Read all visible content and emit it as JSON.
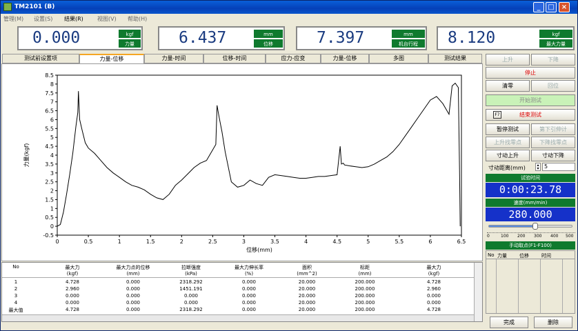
{
  "window": {
    "title": "TM2101 (B)"
  },
  "menu": [
    "管理(M)",
    "设置(S)",
    "结果(R)",
    "视图(V)",
    "帮助(H)"
  ],
  "readouts": [
    {
      "value": "0.000",
      "unit": "kgf",
      "label": "力量"
    },
    {
      "value": "6.437",
      "unit": "mm",
      "label": "位移"
    },
    {
      "value": "7.397",
      "unit": "mm",
      "label": "机台行程"
    },
    {
      "value": "8.120",
      "unit": "kgf",
      "label": "最大力量"
    }
  ],
  "tabs": [
    "测试前设置项",
    "力量-位移",
    "力量-时间",
    "位移-时间",
    "应力-应变",
    "力量-位移",
    "多图",
    "测试结果"
  ],
  "active_tab": 1,
  "chart_data": {
    "type": "line",
    "xlabel": "位移(mm)",
    "ylabel": "力量(kgf)",
    "xlim": [
      0,
      6.5
    ],
    "ylim": [
      -0.5,
      8.5
    ],
    "x_ticks": [
      "0",
      "0.5",
      "1",
      "1.5",
      "2",
      "2.5",
      "3",
      "3.5",
      "4",
      "4.5",
      "5",
      "5.5",
      "6",
      "6.5"
    ],
    "y_ticks": [
      "-0.5",
      "0",
      "0.5",
      "1",
      "1.5",
      "2",
      "2.5",
      "3",
      "3.5",
      "4",
      "4.5",
      "5",
      "5.5",
      "6",
      "6.5",
      "7",
      "7.5",
      "8",
      "8.5"
    ],
    "grid": false,
    "series": [
      {
        "color": "#000000",
        "x": [
          0,
          0.05,
          0.1,
          0.15,
          0.2,
          0.25,
          0.3,
          0.33,
          0.34,
          0.36,
          0.4,
          0.45,
          0.5,
          0.6,
          0.7,
          0.8,
          0.9,
          1.0,
          1.1,
          1.2,
          1.3,
          1.4,
          1.5,
          1.6,
          1.7,
          1.8,
          1.9,
          2.0,
          2.1,
          2.2,
          2.3,
          2.4,
          2.5,
          2.55,
          2.57,
          2.6,
          2.65,
          2.7,
          2.8,
          2.9,
          2.95,
          3.0,
          3.1,
          3.2,
          3.3,
          3.4,
          3.5,
          3.6,
          3.7,
          3.8,
          3.9,
          4.0,
          4.1,
          4.2,
          4.3,
          4.4,
          4.5,
          4.55,
          4.57,
          4.6,
          4.62,
          4.7,
          4.8,
          4.9,
          5.0,
          5.1,
          5.2,
          5.3,
          5.4,
          5.5,
          5.6,
          5.7,
          5.8,
          5.9,
          6.0,
          6.1,
          6.2,
          6.3,
          6.35,
          6.4,
          6.45,
          6.47,
          6.48
        ],
        "y": [
          0.0,
          0.1,
          0.8,
          1.8,
          2.9,
          4.1,
          5.6,
          6.4,
          7.6,
          6.0,
          5.4,
          4.7,
          4.4,
          4.1,
          3.7,
          3.3,
          3.0,
          2.75,
          2.5,
          2.3,
          2.2,
          2.05,
          1.8,
          1.6,
          1.5,
          1.8,
          2.3,
          2.6,
          2.95,
          3.3,
          3.55,
          3.7,
          4.3,
          4.6,
          6.8,
          6.2,
          5.3,
          4.2,
          2.5,
          2.2,
          2.25,
          2.3,
          2.6,
          2.4,
          2.3,
          2.75,
          2.9,
          2.85,
          2.8,
          2.75,
          2.7,
          2.7,
          2.75,
          2.8,
          2.8,
          2.85,
          2.9,
          4.5,
          3.5,
          3.55,
          3.45,
          3.4,
          3.35,
          3.3,
          3.35,
          3.5,
          3.7,
          3.9,
          4.2,
          4.6,
          5.1,
          5.6,
          6.1,
          6.6,
          7.1,
          7.3,
          6.9,
          6.3,
          7.9,
          8.05,
          7.8,
          3.0,
          0.0
        ]
      }
    ]
  },
  "table": {
    "headers": [
      [
        "No",
        ""
      ],
      [
        "最大力",
        "(kgf)"
      ],
      [
        "最大力点的位移",
        "(mm)"
      ],
      [
        "拉断强度",
        "(kPa)"
      ],
      [
        "最大力伸长率",
        "(%)"
      ],
      [
        "面积",
        "(mm^2)"
      ],
      [
        "标距",
        "(mm)"
      ],
      [
        "最大力",
        "(kgf)"
      ]
    ],
    "rows": [
      [
        "1",
        "4.728",
        "0.000",
        "2318.292",
        "0.000",
        "20.000",
        "200.000",
        "4.728"
      ],
      [
        "2",
        "2.960",
        "0.000",
        "1451.191",
        "0.000",
        "20.000",
        "200.000",
        "2.960"
      ],
      [
        "3",
        "0.000",
        "0.000",
        "0.000",
        "0.000",
        "20.000",
        "200.000",
        "0.000"
      ],
      [
        "4",
        "0.000",
        "0.000",
        "0.000",
        "0.000",
        "20.000",
        "200.000",
        "0.000"
      ],
      [
        "最大值",
        "4.728",
        "0.000",
        "2318.292",
        "0.000",
        "20.000",
        "200.000",
        "4.728"
      ]
    ]
  },
  "right_panel": {
    "up": "上升",
    "down": "下降",
    "stop": "停止",
    "clear": "清零",
    "home": "回位",
    "start_test": "开始测试",
    "f7": "F7",
    "end_test": "结束测试",
    "pause_test": "暂停测试",
    "next_pull": "第下引伸计",
    "up_seek": "上升找零点",
    "down_seek": "下降找零点",
    "jog_up": "寸动上升",
    "jog_down": "寸动下降",
    "jog_distance_label": "寸动距离(mm)",
    "jog_distance_value": "5",
    "test_time_label": "试验时间",
    "test_time_value": "0:00:23.78",
    "speed_label": "速度(mm/min)",
    "speed_value": "280.000",
    "slider_value": 280,
    "slider_ticks": [
      "0",
      "100",
      "200",
      "300",
      "400",
      "500"
    ],
    "manual_points_label": "手动取点(F1-F100)",
    "point_columns": [
      "No",
      "力量",
      "位移",
      "时间"
    ],
    "btn_delete": "删除",
    "btn_complete": "完成"
  }
}
